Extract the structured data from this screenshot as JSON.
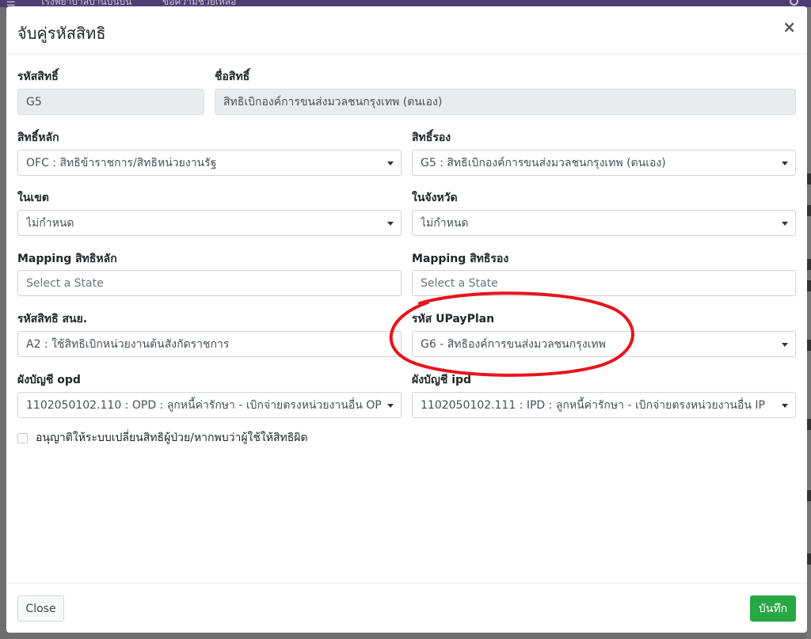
{
  "background": {
    "nav_text_1": "โรงพยาบาลบ้านบันบัน",
    "nav_text_2": "ขอความช่วยเหลือ"
  },
  "modal": {
    "title": "จับคู่รหัสสิทธิ",
    "close_symbol": "×"
  },
  "form": {
    "right_code": {
      "label": "รหัสสิทธิ์",
      "value": "G5"
    },
    "right_name": {
      "label": "ชื่อสิทธิ์",
      "value": "สิทธิเบิกองค์การขนส่งมวลชนกรุงเทพ (ตนเอง)"
    },
    "main_right": {
      "label": "สิทธิ์หลัก",
      "value": "OFC : สิทธิข้าราชการ/สิทธิหน่วยงานรัฐ"
    },
    "sub_right": {
      "label": "สิทธิ์รอง",
      "value": "G5 : สิทธิเบิกองค์การขนส่งมวลชนกรุงเทพ (ตนเอง)"
    },
    "in_zone": {
      "label": "ในเขต",
      "value": "ไม่กำหนด"
    },
    "in_province": {
      "label": "ในจังหวัด",
      "value": "ไม่กำหนด"
    },
    "mapping_main": {
      "label": "Mapping สิทธิหลัก",
      "placeholder": "Select a State"
    },
    "mapping_sub": {
      "label": "Mapping สิทธิรอง",
      "placeholder": "Select a State"
    },
    "nhso_code": {
      "label": "รหัสสิทธิ สนย.",
      "value": "A2 : ใช้สิทธิเบิกหน่วยงานต้นสังกัดราชการ"
    },
    "upayplan": {
      "label": "รหัส UPayPlan",
      "value": "G6 - สิทธิองค์การขนส่งมวลชนกรุงเทพ"
    },
    "opd_account": {
      "label": "ผังบัญชี opd",
      "value": "1102050102.110 : OPD : ลูกหนี้ค่ารักษา - เบิกจ่ายตรงหน่วยงานอื่น OP"
    },
    "ipd_account": {
      "label": "ผังบัญชี ipd",
      "value": "1102050102.111 : IPD : ลูกหนี้ค่ารักษา - เบิกจ่ายตรงหน่วยงานอื่น IP"
    },
    "allow_change": {
      "label": "อนุญาติให้ระบบเปลี่ยนสิทธิผู้ป่วย/หากพบว่าผู้ใช้ให้สิทธิผิด",
      "checked": false
    }
  },
  "footer": {
    "close_label": "Close",
    "save_label": "บันทึก"
  },
  "colors": {
    "save_button": "#28a745",
    "annotation_circle": "#e8141b",
    "readonly_field": "#e9ecef"
  }
}
